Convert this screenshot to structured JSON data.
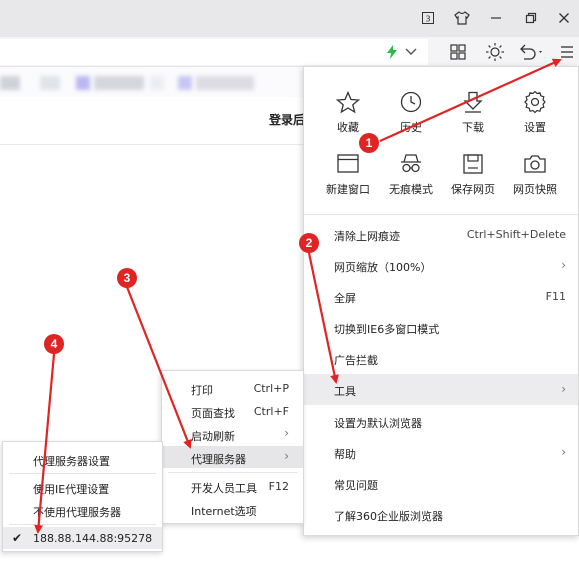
{
  "window": {
    "title_buttons": [
      {
        "name": "tab-count-icon",
        "glyph": "3"
      },
      {
        "name": "skin-shirt-icon"
      },
      {
        "name": "minimize-icon",
        "glyph": "—"
      },
      {
        "name": "restore-icon"
      },
      {
        "name": "close-icon",
        "glyph": "✕"
      }
    ]
  },
  "content": {
    "login_label": "登录后"
  },
  "main_menu": {
    "grid": [
      {
        "label": "收藏",
        "icon": "star-icon"
      },
      {
        "label": "历史",
        "icon": "clock-icon"
      },
      {
        "label": "下载",
        "icon": "download-icon"
      },
      {
        "label": "设置",
        "icon": "gear-icon"
      },
      {
        "label": "新建窗口",
        "icon": "new-window-icon"
      },
      {
        "label": "无痕模式",
        "icon": "incognito-icon"
      },
      {
        "label": "保存网页",
        "icon": "save-page-icon"
      },
      {
        "label": "网页快照",
        "icon": "camera-icon"
      }
    ],
    "items": [
      {
        "label": "清除上网痕迹",
        "shortcut": "Ctrl+Shift+Delete"
      },
      {
        "label": "网页缩放（100%）",
        "submenu": true
      },
      {
        "label": "全屏",
        "shortcut": "F11"
      },
      {
        "label": "切换到IE6多窗口模式"
      },
      {
        "label": "广告拦截"
      },
      {
        "label": "工具",
        "submenu": true
      },
      {
        "label": "设置为默认浏览器"
      },
      {
        "label": "帮助",
        "submenu": true
      },
      {
        "label": "常见问题"
      },
      {
        "label": "了解360企业版浏览器"
      }
    ],
    "highlighted": "工具"
  },
  "tools_menu": {
    "items": [
      {
        "label": "打印",
        "shortcut": "Ctrl+P"
      },
      {
        "label": "页面查找",
        "shortcut": "Ctrl+F"
      },
      {
        "label": "启动刷新",
        "submenu": true
      },
      {
        "label": "代理服务器",
        "submenu": true
      },
      {
        "label": "开发人员工具",
        "shortcut": "F12"
      },
      {
        "label": "Internet选项"
      }
    ],
    "highlighted": "代理服务器"
  },
  "proxy_menu": {
    "items": [
      {
        "label": "代理服务器设置"
      },
      {
        "label": "使用IE代理设置"
      },
      {
        "label": "不使用代理服务器"
      },
      {
        "label": "188.88.144.88:95278",
        "checked": true
      }
    ]
  },
  "annotations": {
    "badges": [
      "1",
      "2",
      "3",
      "4"
    ],
    "color": "#e02424"
  },
  "colors": {
    "accent_green": "#2fb84b",
    "annotation_red": "#e02424"
  }
}
